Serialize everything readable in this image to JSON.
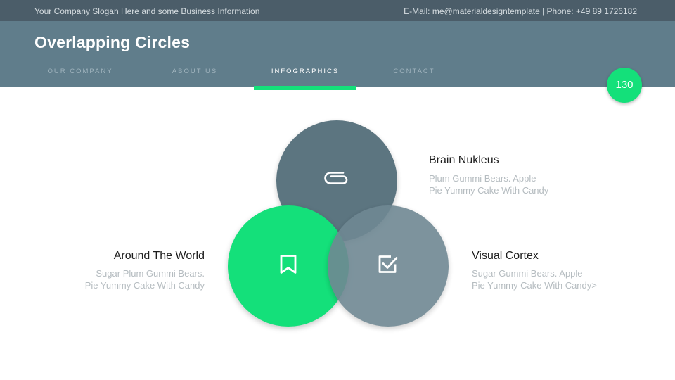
{
  "topbar": {
    "slogan": "Your Company Slogan Here and some Business Information",
    "contact": "E-Mail: me@materialdesigntemplate | Phone: +49 89 1726182"
  },
  "header": {
    "title": "Overlapping Circles"
  },
  "nav": {
    "items": [
      {
        "label": "OUR COMPANY"
      },
      {
        "label": "ABOUT US"
      },
      {
        "label": "INFOGRAPHICS"
      },
      {
        "label": "CONTACT"
      }
    ],
    "active": "INFOGRAPHICS"
  },
  "page_number": "130",
  "colors": {
    "topbar": "#4b5d69",
    "header": "#607d8b",
    "accent": "#14e07a",
    "circle_dark": "#546e7a",
    "circle_grey": "#6f8893"
  },
  "circles": [
    {
      "icon": "paperclip-icon",
      "title": "Brain Nukleus",
      "line1": "Plum Gummi Bears. Apple",
      "line2": "Pie Yummy Cake With Candy"
    },
    {
      "icon": "bookmark-icon",
      "title": "Around The World",
      "line1": "Sugar Plum Gummi Bears.",
      "line2": "Pie Yummy Cake With Candy"
    },
    {
      "icon": "checkbox-icon",
      "title": "Visual Cortex",
      "line1": "Sugar Gummi Bears. Apple",
      "line2": "Pie Yummy Cake With Candy>"
    }
  ]
}
